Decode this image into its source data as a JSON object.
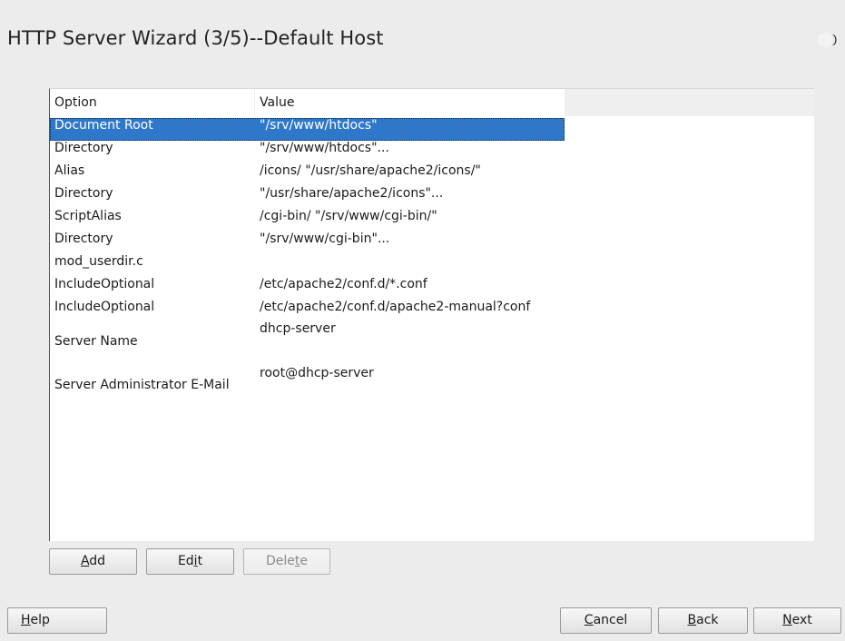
{
  "window": {
    "title": "HTTP Server Wizard (3/5)--Default Host"
  },
  "table": {
    "columns": [
      "Option",
      "Value"
    ],
    "rows": [
      {
        "option": "Document Root",
        "value": "\"/srv/www/htdocs\"",
        "selected": true
      },
      {
        "option": "Directory",
        "value": "\"/srv/www/htdocs\"..."
      },
      {
        "option": "Alias",
        "value": "/icons/ \"/usr/share/apache2/icons/\""
      },
      {
        "option": "Directory",
        "value": "\"/usr/share/apache2/icons\"..."
      },
      {
        "option": "ScriptAlias",
        "value": "/cgi-bin/ \"/srv/www/cgi-bin/\""
      },
      {
        "option": "Directory",
        "value": "\"/srv/www/cgi-bin\"..."
      },
      {
        "option": "mod_userdir.c",
        "value": ""
      },
      {
        "option": "IncludeOptional",
        "value": "/etc/apache2/conf.d/*.conf"
      },
      {
        "option": "IncludeOptional",
        "value": "/etc/apache2/conf.d/apache2-manual?conf"
      },
      {
        "option": "Server Name",
        "value": "dhcp-server"
      },
      {
        "option": "Server Administrator E-Mail",
        "value": "root@dhcp-server"
      }
    ]
  },
  "table_buttons": {
    "add": {
      "pre": "",
      "key": "A",
      "post": "dd"
    },
    "edit": {
      "pre": "Ed",
      "key": "i",
      "post": "t"
    },
    "delete": {
      "pre": "Dele",
      "key": "t",
      "post": "e",
      "disabled": true
    }
  },
  "footer_buttons": {
    "help": {
      "pre": "",
      "key": "H",
      "post": "elp"
    },
    "cancel": {
      "pre": "",
      "key": "C",
      "post": "ancel"
    },
    "back": {
      "pre": "",
      "key": "B",
      "post": "ack"
    },
    "next": {
      "pre": "",
      "key": "N",
      "post": "ext"
    }
  },
  "colors": {
    "selection": "#2f78c9",
    "background": "#ececec"
  },
  "icons": {
    "logo": "opensuse-logo-icon"
  }
}
